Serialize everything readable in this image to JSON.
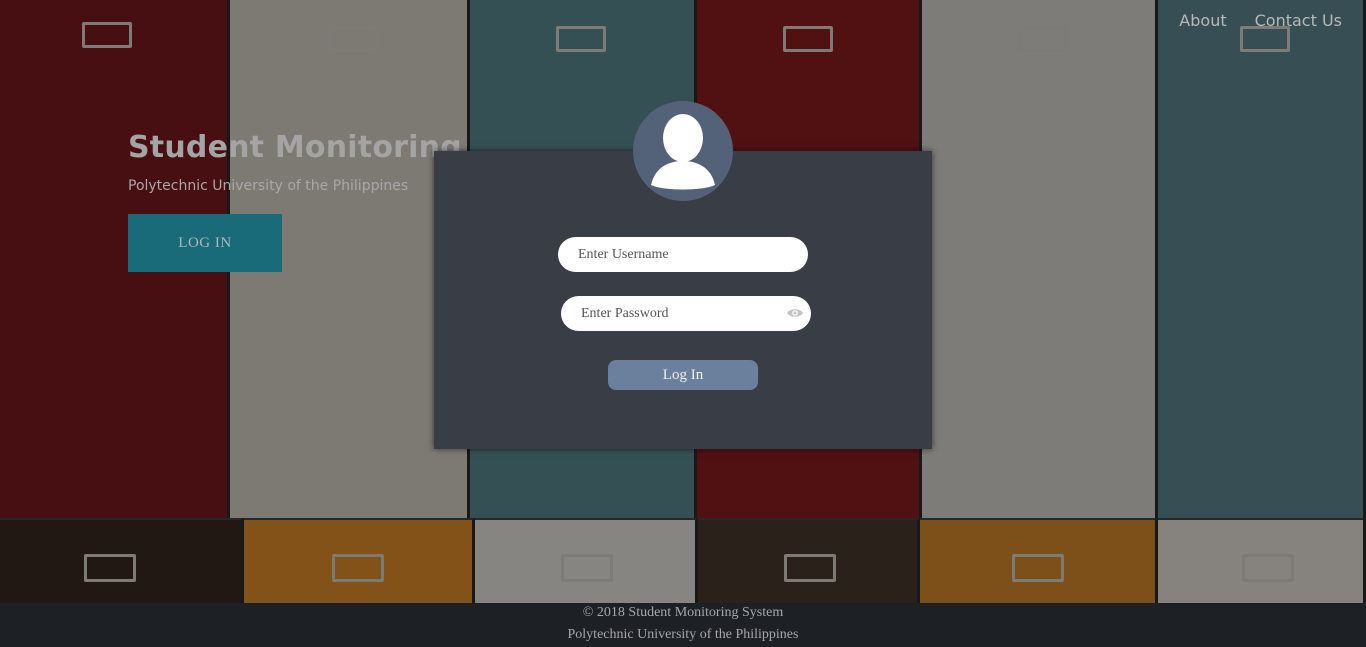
{
  "nav": {
    "about": "About",
    "contact": "Contact Us"
  },
  "hero": {
    "title": "Student Monitoring",
    "subtitle": "Polytechnic University of the Philippines",
    "button": "LOG IN"
  },
  "login": {
    "username_placeholder": "Enter Username",
    "password_placeholder": "Enter Password",
    "button": "Log In"
  },
  "footer": {
    "copyright": "© 2018 Student Monitoring System",
    "university": "Polytechnic University of the Philippines"
  },
  "colors": {
    "card": "#393d46",
    "avatar": "#536179",
    "hero_button": "#1a6b7a",
    "login_button": "#6b809c",
    "footer": "#1d2125"
  },
  "icons": {
    "avatar": "user-silhouette-icon",
    "password_toggle": "eye-icon"
  }
}
